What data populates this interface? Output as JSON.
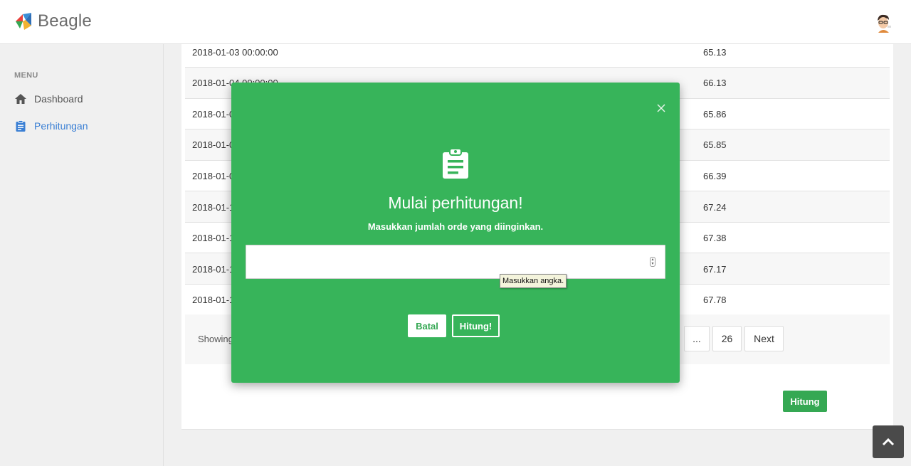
{
  "app": {
    "name": "Beagle"
  },
  "sidebar": {
    "menu_title": "MENU",
    "items": [
      {
        "label": "Dashboard",
        "icon": "home-icon",
        "active": false
      },
      {
        "label": "Perhitungan",
        "icon": "clipboard-icon",
        "active": true
      }
    ]
  },
  "table": {
    "rows": [
      {
        "date": "2018-01-03 00:00:00",
        "value": "65.13"
      },
      {
        "date": "2018-01-04 00:00:00",
        "value": "66.13"
      },
      {
        "date": "2018-01-0",
        "value": "65.86"
      },
      {
        "date": "2018-01-0",
        "value": "65.85"
      },
      {
        "date": "2018-01-0",
        "value": "66.39"
      },
      {
        "date": "2018-01-1",
        "value": "67.24"
      },
      {
        "date": "2018-01-1",
        "value": "67.38"
      },
      {
        "date": "2018-01-1",
        "value": "67.17"
      },
      {
        "date": "2018-01-1",
        "value": "67.78"
      }
    ]
  },
  "pagination": {
    "showing": "Showing",
    "ellipsis": "...",
    "last_page": "26",
    "next": "Next"
  },
  "actions": {
    "hitung": "Hitung"
  },
  "modal": {
    "title": "Mulai perhitungan!",
    "subtitle": "Masukkan jumlah orde yang diinginkan.",
    "input_value": "",
    "tooltip": "Masukkan angka.",
    "cancel": "Batal",
    "confirm": "Hitung!"
  },
  "colors": {
    "accent_green": "#37b45a",
    "active_blue": "#3a7fd4"
  }
}
